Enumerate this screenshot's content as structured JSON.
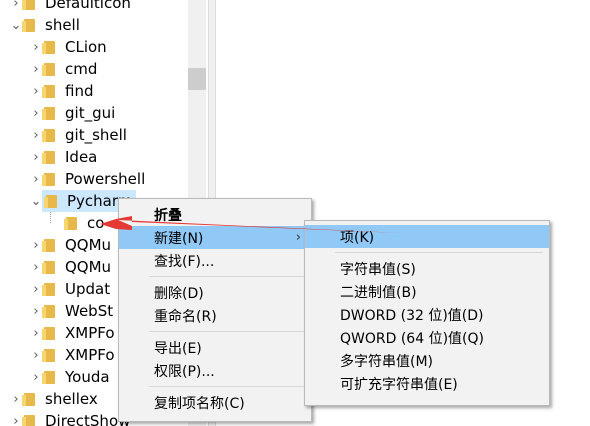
{
  "tree": {
    "items": [
      {
        "label": "Defaulticon",
        "expanded": false
      },
      {
        "label": "shell",
        "expanded": true
      },
      {
        "label": "CLion",
        "expanded": false
      },
      {
        "label": "cmd",
        "expanded": false
      },
      {
        "label": "find",
        "expanded": false
      },
      {
        "label": "git_gui",
        "expanded": false
      },
      {
        "label": "git_shell",
        "expanded": false
      },
      {
        "label": "Idea",
        "expanded": false
      },
      {
        "label": "Powershell",
        "expanded": false
      },
      {
        "label": "Pycharm",
        "expanded": true
      },
      {
        "label": "co",
        "expanded": false
      },
      {
        "label": "QQMu",
        "expanded": false
      },
      {
        "label": "QQMu",
        "expanded": false
      },
      {
        "label": "Updat",
        "expanded": false
      },
      {
        "label": "WebSt",
        "expanded": false
      },
      {
        "label": "XMPFo",
        "expanded": false
      },
      {
        "label": "XMPFo",
        "expanded": false
      },
      {
        "label": "Youda",
        "expanded": false
      },
      {
        "label": "shellex",
        "expanded": false
      },
      {
        "label": "DirectShow",
        "expanded": false
      }
    ]
  },
  "context_menu": {
    "collapse": "折叠",
    "new": "新建(N)",
    "find": "查找(F)...",
    "delete": "删除(D)",
    "rename": "重命名(R)",
    "export": "导出(E)",
    "permissions": "权限(P)...",
    "copy_key_name": "复制项名称(C)"
  },
  "submenu": {
    "key": "项(K)",
    "string_value": "字符串值(S)",
    "binary_value": "二进制值(B)",
    "dword_value": "DWORD (32 位)值(D)",
    "qword_value": "QWORD (64 位)值(Q)",
    "multi_string_value": "多字符串值(M)",
    "expandable_string_value": "可扩充字符串值(E)"
  },
  "colors": {
    "highlight": "#90c8f6",
    "selection": "#cce8ff",
    "annotation_arrow": "#e53935"
  }
}
